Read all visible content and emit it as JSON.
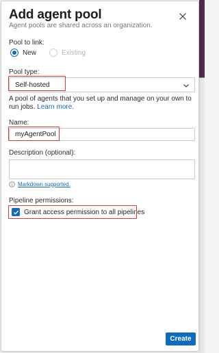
{
  "dialog": {
    "title": "Add agent pool",
    "subtitle": "Agent pools are shared across an organization."
  },
  "pool_link": {
    "label": "Pool to link:",
    "options": [
      {
        "label": "New",
        "selected": true,
        "enabled": true
      },
      {
        "label": "Existing",
        "selected": false,
        "enabled": false
      }
    ]
  },
  "pool_type": {
    "label": "Pool type:",
    "value": "Self-hosted",
    "help_text": "A pool of agents that you set up and manage on your own to run jobs.",
    "learn_more": "Learn more."
  },
  "name": {
    "label": "Name:",
    "value": "myAgentPool"
  },
  "description": {
    "label": "Description (optional):",
    "value": "",
    "markdown_link": "Markdown supported."
  },
  "pipeline_permissions": {
    "label": "Pipeline permissions:",
    "checkbox_label": "Grant access permission to all pipelines",
    "checked": true
  },
  "actions": {
    "create_label": "Create"
  },
  "colors": {
    "accent": "#0f6cbd",
    "highlight": "#d93636"
  }
}
